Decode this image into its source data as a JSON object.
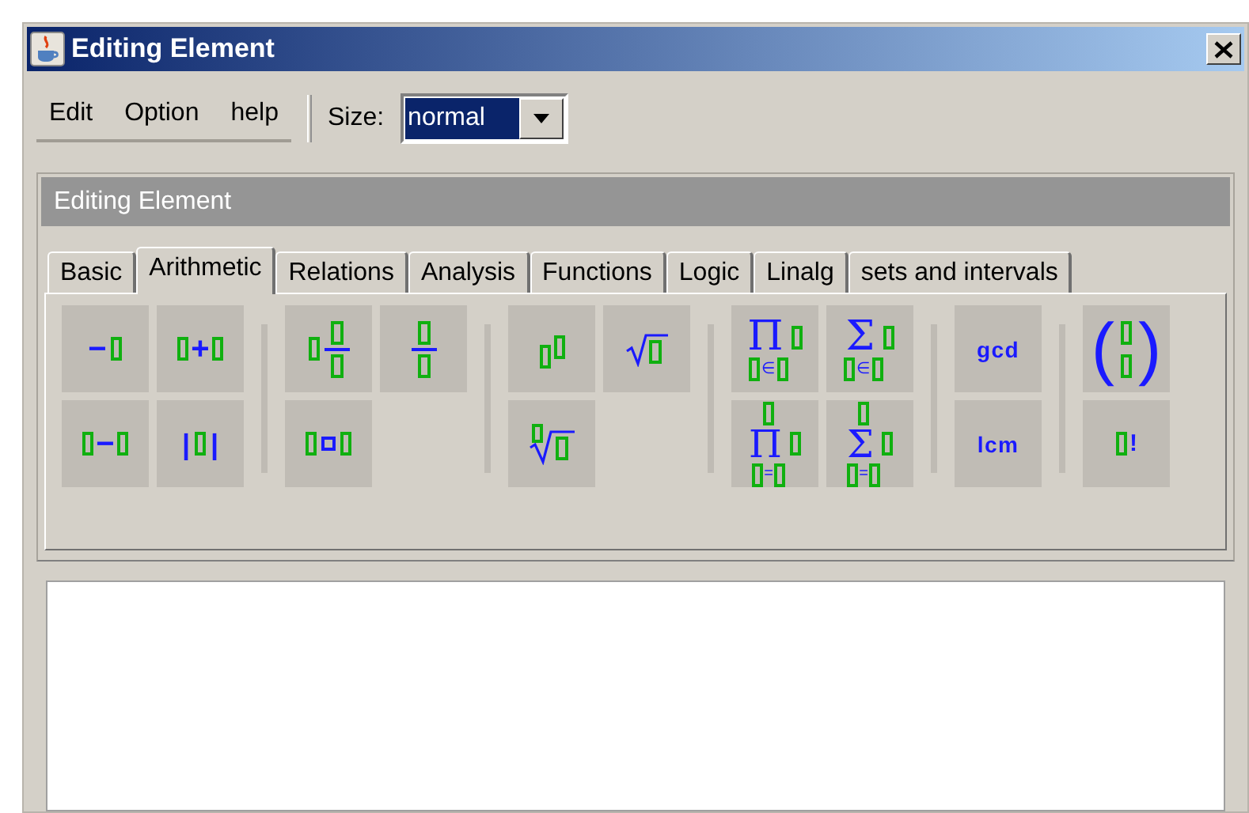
{
  "window": {
    "title": "Editing Element"
  },
  "menu": [
    "Edit",
    "Option",
    "help"
  ],
  "size": {
    "label": "Size:",
    "value": "normal"
  },
  "panel": {
    "title": "Editing Element"
  },
  "tabs": [
    {
      "label": "Basic",
      "selected": false
    },
    {
      "label": "Arithmetic",
      "selected": true
    },
    {
      "label": "Relations",
      "selected": false
    },
    {
      "label": "Analysis",
      "selected": false
    },
    {
      "label": "Functions",
      "selected": false
    },
    {
      "label": "Logic",
      "selected": false
    },
    {
      "label": "Linalg",
      "selected": false
    },
    {
      "label": "sets and intervals",
      "selected": false
    }
  ],
  "groups": [
    {
      "rows": [
        [
          {
            "kind": "prefix",
            "symbol": "−"
          },
          {
            "kind": "infix",
            "symbol": "+"
          }
        ],
        [
          {
            "kind": "infix",
            "symbol": "−"
          },
          {
            "kind": "bars",
            "symbol": "|"
          }
        ]
      ]
    },
    {
      "rows": [
        [
          {
            "kind": "mixed"
          },
          {
            "kind": "fraction"
          }
        ],
        [
          {
            "kind": "boxop"
          }
        ]
      ]
    },
    {
      "rows": [
        [
          {
            "kind": "power"
          },
          {
            "kind": "sqrt"
          }
        ],
        [
          {
            "kind": "root"
          }
        ]
      ]
    },
    {
      "rows": [
        [
          {
            "kind": "bigop_in",
            "symbol": "Π",
            "sub": "∈"
          },
          {
            "kind": "bigop_in",
            "symbol": "Σ",
            "sub": "∈"
          }
        ],
        [
          {
            "kind": "bigop_range",
            "symbol": "Π",
            "sub": "="
          },
          {
            "kind": "bigop_range",
            "symbol": "Σ",
            "sub": "="
          }
        ]
      ]
    },
    {
      "rows": [
        [
          {
            "kind": "word",
            "symbol": "gcd"
          }
        ],
        [
          {
            "kind": "word",
            "symbol": "lcm"
          }
        ]
      ]
    },
    {
      "rows": [
        [
          {
            "kind": "binom",
            "symbol": "(",
            "close": ")"
          }
        ],
        [
          {
            "kind": "postfix",
            "symbol": "!"
          }
        ]
      ]
    }
  ]
}
